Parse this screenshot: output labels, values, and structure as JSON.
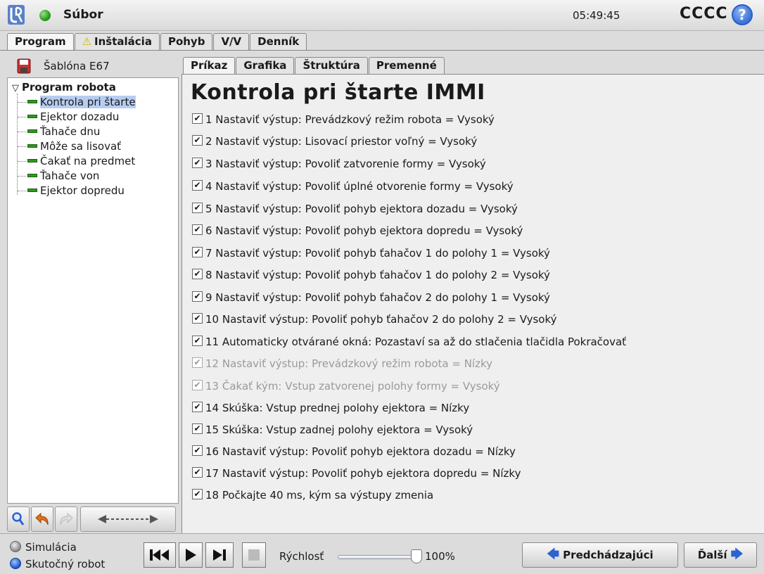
{
  "app": {
    "file_menu": "Súbor",
    "clock": "05:49:45",
    "robot_name": "CCCC",
    "help_symbol": "?"
  },
  "main_tabs": [
    {
      "label": "Program",
      "active": true
    },
    {
      "label": "Inštalácia",
      "warning": true
    },
    {
      "label": "Pohyb"
    },
    {
      "label": "V/V"
    },
    {
      "label": "Denník"
    }
  ],
  "template": {
    "name": "Šablóna E67"
  },
  "tree": {
    "root": "Program robota",
    "items": [
      {
        "label": "Kontrola pri štarte",
        "selected": true
      },
      {
        "label": "Ejektor dozadu"
      },
      {
        "label": "Ťahače dnu"
      },
      {
        "label": "Môže sa lisovať"
      },
      {
        "label": "Čakať na predmet"
      },
      {
        "label": "Ťahače von"
      },
      {
        "label": "Ejektor dopredu"
      }
    ]
  },
  "sub_tabs": [
    {
      "label": "Príkaz",
      "active": true
    },
    {
      "label": "Grafika"
    },
    {
      "label": "Štruktúra"
    },
    {
      "label": "Premenné"
    }
  ],
  "content": {
    "title": "Kontrola pri štarte IMMI",
    "commands": [
      {
        "text": "1 Nastaviť výstup: Prevádzkový režim robota = Vysoký",
        "checked": true,
        "enabled": true
      },
      {
        "text": "2 Nastaviť výstup: Lisovací priestor voľný = Vysoký",
        "checked": true,
        "enabled": true
      },
      {
        "text": "3 Nastaviť výstup: Povoliť zatvorenie formy = Vysoký",
        "checked": true,
        "enabled": true
      },
      {
        "text": "4 Nastaviť výstup: Povoliť úplné otvorenie formy = Vysoký",
        "checked": true,
        "enabled": true
      },
      {
        "text": "5 Nastaviť výstup: Povoliť pohyb ejektora dozadu = Vysoký",
        "checked": true,
        "enabled": true
      },
      {
        "text": "6 Nastaviť výstup: Povoliť pohyb ejektora dopredu = Vysoký",
        "checked": true,
        "enabled": true
      },
      {
        "text": "7 Nastaviť výstup: Povoliť pohyb ťahačov 1 do polohy 1 = Vysoký",
        "checked": true,
        "enabled": true
      },
      {
        "text": "8 Nastaviť výstup: Povoliť pohyb ťahačov 1 do polohy 2 = Vysoký",
        "checked": true,
        "enabled": true
      },
      {
        "text": "9 Nastaviť výstup: Povoliť pohyb ťahačov 2 do polohy 1 = Vysoký",
        "checked": true,
        "enabled": true
      },
      {
        "text": "10 Nastaviť výstup: Povoliť pohyb ťahačov 2 do polohy 2 = Vysoký",
        "checked": true,
        "enabled": true
      },
      {
        "text": "11 Automaticky otvárané okná: Pozastaví sa až do stlačenia tlačidla Pokračovať",
        "checked": true,
        "enabled": true
      },
      {
        "text": "12 Nastaviť výstup: Prevádzkový režim robota = Nízky",
        "checked": true,
        "enabled": false
      },
      {
        "text": "13 Čakať kým: Vstup zatvorenej polohy formy = Vysoký",
        "checked": true,
        "enabled": false
      },
      {
        "text": "14 Skúška: Vstup prednej polohy ejektora = Nízky",
        "checked": true,
        "enabled": true
      },
      {
        "text": "15 Skúška: Vstup zadnej polohy ejektora = Vysoký",
        "checked": true,
        "enabled": true
      },
      {
        "text": "16 Nastaviť výstup: Povoliť pohyb ejektora dozadu = Nízky",
        "checked": true,
        "enabled": true
      },
      {
        "text": "17 Nastaviť výstup: Povoliť pohyb ejektora dopredu = Nízky",
        "checked": true,
        "enabled": true
      },
      {
        "text": "18 Počkajte 40 ms, kým sa výstupy zmenia",
        "checked": true,
        "enabled": true
      }
    ]
  },
  "bottom": {
    "modes": [
      {
        "label": "Simulácia",
        "selected": false
      },
      {
        "label": "Skutočný robot",
        "selected": true
      }
    ],
    "speed_label": "Rýchlosť",
    "speed_value": "100%",
    "speed_fraction": 1.0,
    "prev_label": "Predchádzajúci",
    "next_label": "Ďalší"
  },
  "icons": {
    "logo": "ur-logo-icon",
    "status": "status-ok-icon",
    "help": "help-icon",
    "warning": "warning-icon",
    "checkmark": "✔",
    "play_controls": [
      "skip-back-icon",
      "play-icon",
      "step-icon",
      "stop-icon"
    ]
  },
  "colors": {
    "status_green": "#2a9a1a",
    "tree_selected": "#b7cdf0",
    "node_bar": "#2c9a1c",
    "accent_blue": "#2c63d0",
    "warning_yellow": "#d8b400"
  }
}
